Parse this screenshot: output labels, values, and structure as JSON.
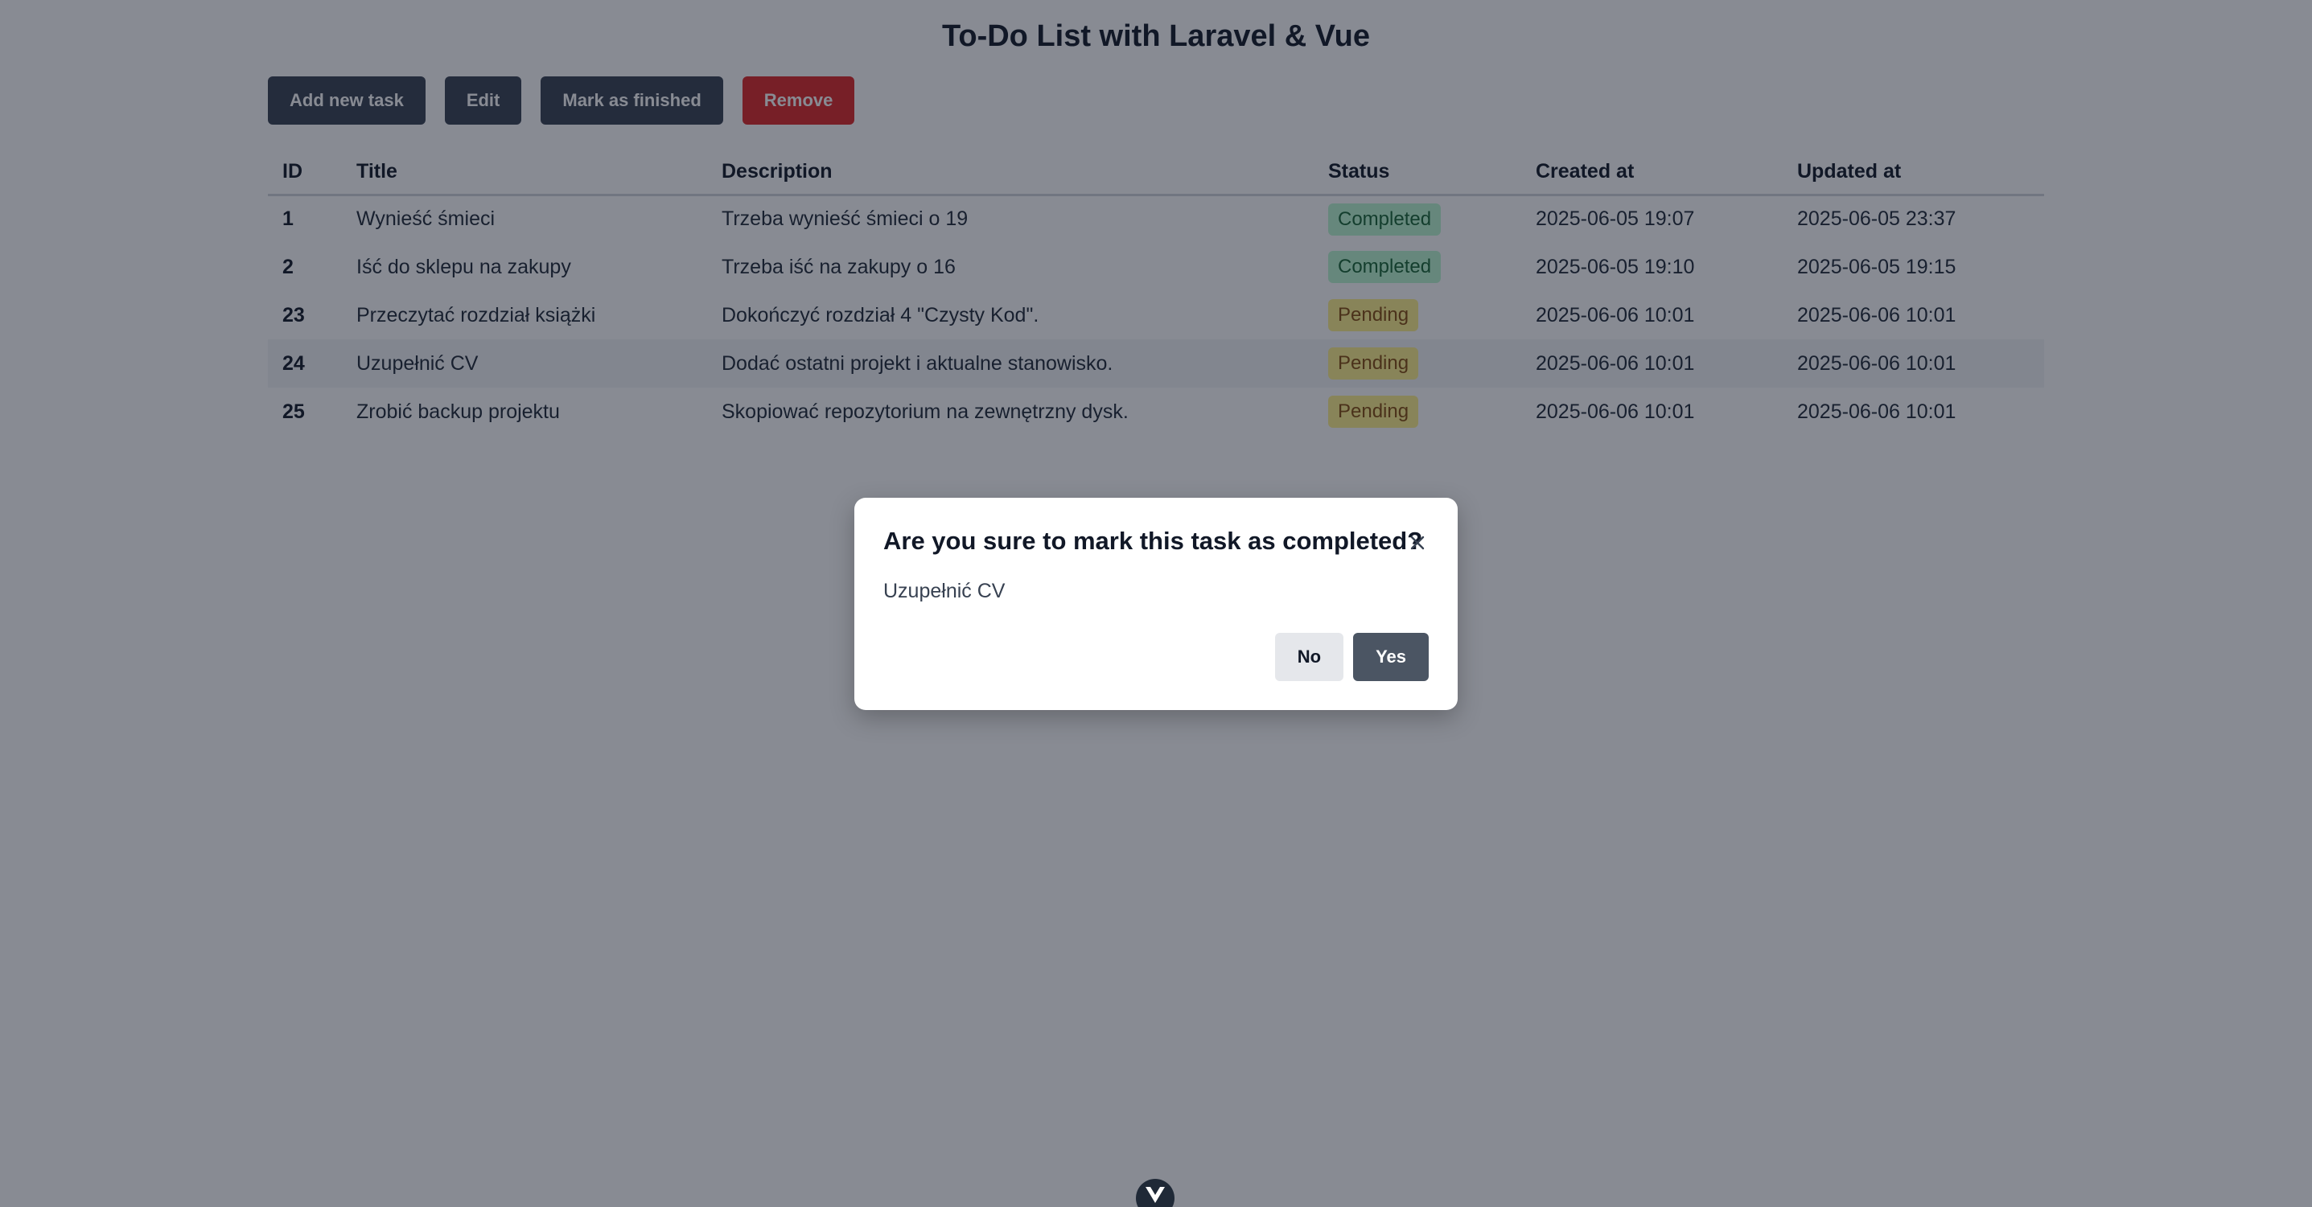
{
  "page": {
    "title": "To-Do List with Laravel & Vue"
  },
  "toolbar": {
    "add_label": "Add new task",
    "edit_label": "Edit",
    "finish_label": "Mark as finished",
    "remove_label": "Remove"
  },
  "table": {
    "headers": {
      "id": "ID",
      "title": "Title",
      "description": "Description",
      "status": "Status",
      "created": "Created at",
      "updated": "Updated at"
    },
    "rows": [
      {
        "id": "1",
        "title": "Wynieść śmieci",
        "description": "Trzeba wynieść śmieci o 19",
        "status": "Completed",
        "created": "2025-06-05 19:07",
        "updated": "2025-06-05 23:37"
      },
      {
        "id": "2",
        "title": "Iść do sklepu na zakupy",
        "description": "Trzeba iść na zakupy o 16",
        "status": "Completed",
        "created": "2025-06-05 19:10",
        "updated": "2025-06-05 19:15"
      },
      {
        "id": "23",
        "title": "Przeczytać rozdział książki",
        "description": "Dokończyć rozdział 4 \"Czysty Kod\".",
        "status": "Pending",
        "created": "2025-06-06 10:01",
        "updated": "2025-06-06 10:01"
      },
      {
        "id": "24",
        "title": "Uzupełnić CV",
        "description": "Dodać ostatni projekt i aktualne stanowisko.",
        "status": "Pending",
        "created": "2025-06-06 10:01",
        "updated": "2025-06-06 10:01"
      },
      {
        "id": "25",
        "title": "Zrobić backup projektu",
        "description": "Skopiować repozytorium na zewnętrzny dysk.",
        "status": "Pending",
        "created": "2025-06-06 10:01",
        "updated": "2025-06-06 10:01"
      }
    ]
  },
  "modal": {
    "title": "Are you sure to mark this task as completed?",
    "task_name": "Uzupełnić CV",
    "no_label": "No",
    "yes_label": "Yes",
    "close_icon": "close-icon"
  },
  "devtools": {
    "icon": "vue-devtools-icon"
  },
  "colors": {
    "toolbar_button": "#374151",
    "remove_button": "#dc2626",
    "completed_badge_bg": "#bbf7d0",
    "completed_badge_text": "#166534",
    "pending_badge_bg": "#fef08a",
    "pending_badge_text": "#854d0e",
    "overlay": "rgba(17,24,39,0.5)",
    "yes_button": "#4b5563"
  }
}
